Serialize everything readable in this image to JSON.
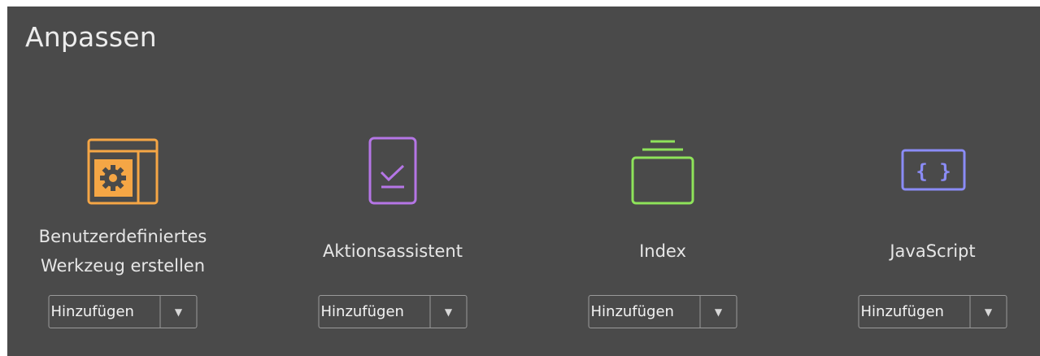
{
  "header": {
    "title": "Anpassen"
  },
  "tools": [
    {
      "label": "Benutzerdefiniertes Werkzeug erstellen",
      "icon": "custom-tool-gear-icon",
      "color": "#f5a645",
      "add_label": "Hinzufügen",
      "dropdown_icon": "caret-down-icon"
    },
    {
      "label": "Aktionsassistent",
      "icon": "action-wizard-check-icon",
      "color": "#b576e6",
      "add_label": "Hinzufügen",
      "dropdown_icon": "caret-down-icon"
    },
    {
      "label": "Index",
      "icon": "index-stack-icon",
      "color": "#8ee35a",
      "add_label": "Hinzufügen",
      "dropdown_icon": "caret-down-icon"
    },
    {
      "label": "JavaScript",
      "icon": "javascript-braces-icon",
      "color": "#8b8cf7",
      "add_label": "Hinzufügen",
      "dropdown_icon": "caret-down-icon"
    }
  ],
  "glyphs": {
    "caret": "▼",
    "braces": "{ }"
  }
}
